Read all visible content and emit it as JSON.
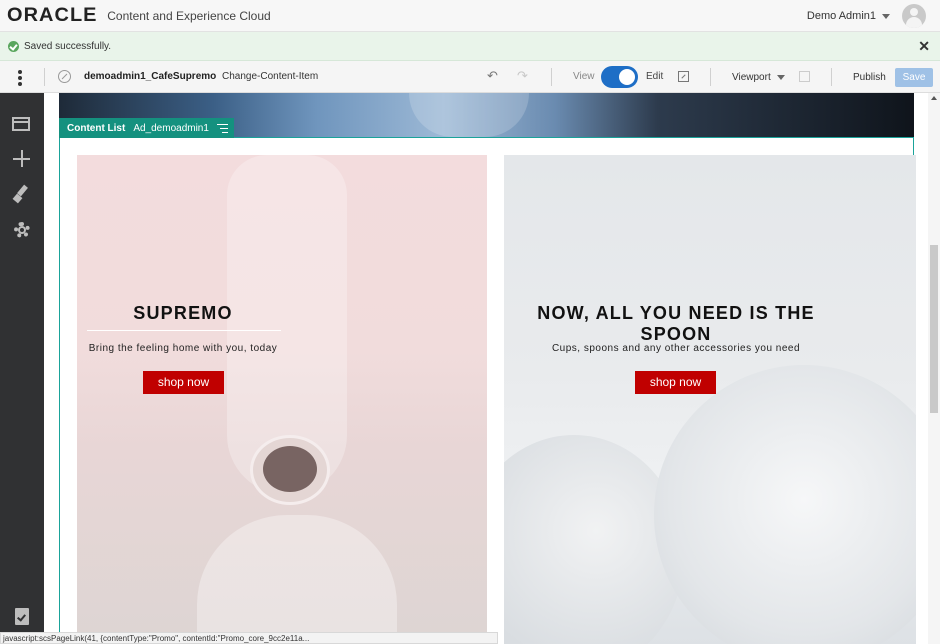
{
  "header": {
    "logo": "ORACLE",
    "app_title": "Content and Experience Cloud",
    "user_name": "Demo Admin1"
  },
  "notification": {
    "message": "Saved successfully.",
    "close_label": "✕"
  },
  "toolbar": {
    "site_name": "demoadmin1_CafeSupremo",
    "content_item": "Change-Content-Item",
    "view_label": "View",
    "edit_label": "Edit",
    "viewport_label": "Viewport",
    "publish_label": "Publish",
    "save_label": "Save",
    "mode": "Edit"
  },
  "sidebar": {
    "items": [
      {
        "icon": "layout-icon"
      },
      {
        "icon": "add-icon"
      },
      {
        "icon": "brush-icon"
      },
      {
        "icon": "gear-icon"
      },
      {
        "icon": "clipboard-check-icon"
      }
    ]
  },
  "content_list": {
    "type_label": "Content List",
    "name": "Ad_demoadmin1",
    "promos": [
      {
        "title": "SUPREMO",
        "subtitle": "Bring the feeling home with you, today",
        "button": "shop now"
      },
      {
        "title": "NOW, ALL YOU NEED IS THE SPOON",
        "subtitle": "Cups, spoons and any other accessories you need",
        "button": "shop now"
      }
    ]
  },
  "status_bar": {
    "text": "javascript:scsPageLink(41, {contentType:\"Promo\", contentId:\"Promo_core_9cc2e11a..."
  },
  "colors": {
    "accent_blue": "#1e6ec6",
    "content_list_teal": "#14917f",
    "shop_button_red": "#c00000",
    "success_green": "#5aa65e"
  }
}
